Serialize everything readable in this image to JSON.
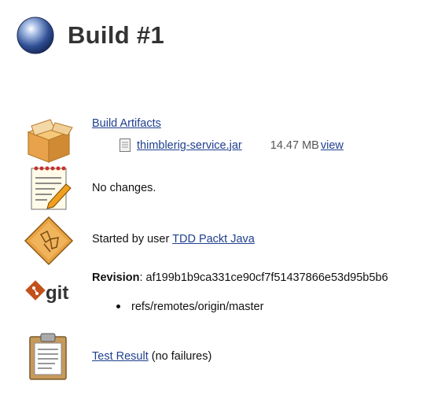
{
  "page": {
    "title": "Build #1"
  },
  "artifacts": {
    "heading": "Build Artifacts",
    "files": [
      {
        "name": "thimblerig-service.jar",
        "size": "14.47 MB",
        "view_label": "view"
      }
    ]
  },
  "changes": {
    "text": "No changes."
  },
  "cause": {
    "prefix": "Started by user ",
    "user": "TDD Packt Java"
  },
  "git": {
    "revision_label": "Revision",
    "revision_sep": ": ",
    "revision": "af199b1b9ca331ce90cf7f51437866e53d95b5b6",
    "branches": [
      "refs/remotes/origin/master"
    ]
  },
  "tests": {
    "link": "Test Result",
    "suffix": " (no failures)"
  },
  "colors": {
    "link": "#1f3f8f",
    "title": "#333333"
  },
  "icons": [
    "blue-ball-icon",
    "package-icon",
    "notepad-icon",
    "user-diamond-icon",
    "git-logo-icon",
    "clipboard-icon",
    "file-icon"
  ]
}
